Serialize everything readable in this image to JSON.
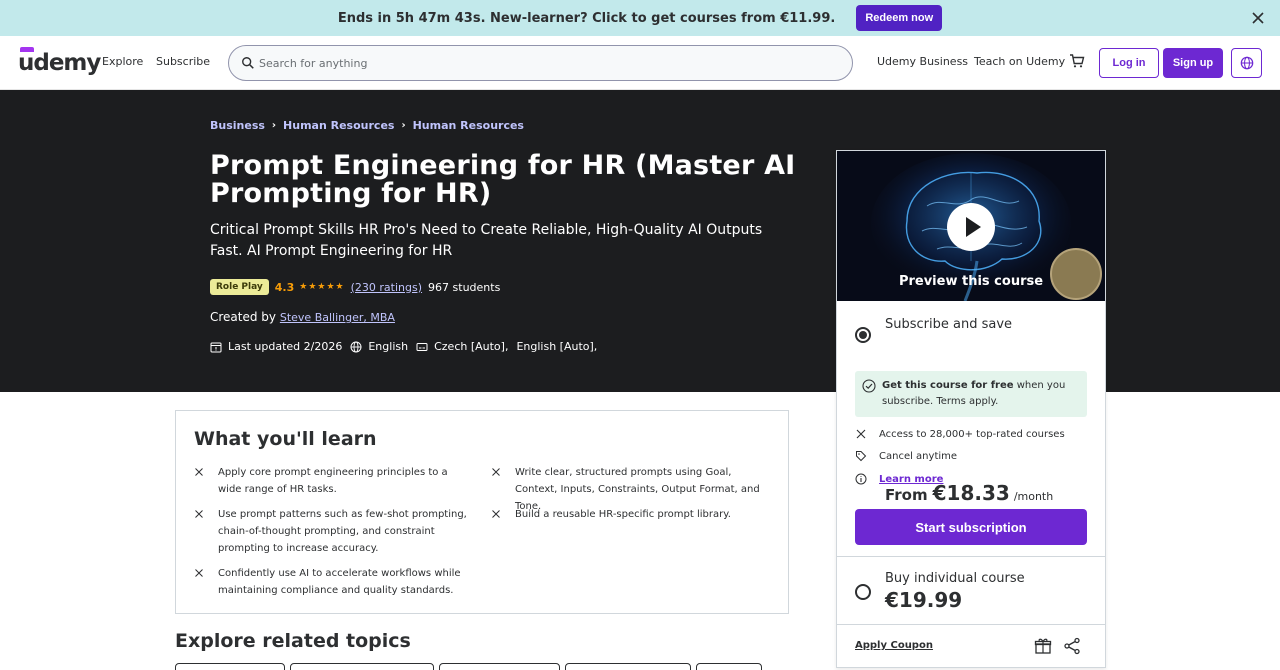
{
  "promo": {
    "text": "Ends in 5h 47m 43s. New-learner? Click to get courses from €11.99.",
    "button": "Redeem now"
  },
  "header": {
    "logo": "udemy",
    "explore": "Explore",
    "subscribe": "Subscribe",
    "search_placeholder": "Search for anything",
    "business": "Udemy Business",
    "teach": "Teach on Udemy",
    "login": "Log in",
    "signup": "Sign up"
  },
  "breadcrumbs": [
    "Business",
    "Human Resources",
    "Human Resources"
  ],
  "course": {
    "title": "Prompt Engineering for HR (Master AI Prompting for HR)",
    "subtitle": "Critical Prompt Skills HR Pro's Need to Create Reliable, High-Quality AI Outputs Fast. AI Prompt Engineering for HR",
    "badge": "Role Play",
    "rating": "4.3",
    "rating_stars": 4.3,
    "rating_count": "(230 ratings)",
    "students": "967 students",
    "created_label": "Created by",
    "author": "Steve Ballinger, MBA",
    "last_updated": "Last updated 2/2026",
    "language": "English",
    "captions": [
      "Czech [Auto],",
      "English [Auto],"
    ]
  },
  "sidebar": {
    "preview": "Preview this course",
    "sub_title": "Subscribe and save",
    "sub_from": "From",
    "sub_price": "€18.33",
    "sub_per": "/month",
    "free_bold": "Get this course for free",
    "free_rest": " when you subscribe. Terms apply.",
    "features": [
      "Access to 28,000+ top-rated courses",
      "Cancel anytime",
      "Learn more"
    ],
    "start_button": "Start subscription",
    "buy_title": "Buy individual course",
    "buy_price": "€19.99",
    "coupon": "Apply Coupon"
  },
  "learn": {
    "heading": "What you'll learn",
    "items": [
      "Apply core prompt engineering principles to a wide range of HR tasks.",
      "Use prompt patterns such as few-shot prompting, chain-of-thought prompting, and constraint prompting to increase accuracy.",
      "Confidently use AI to accelerate workflows while maintaining compliance and quality standards.",
      "Write clear, structured prompts using Goal, Context, Inputs, Constraints, Output Format, and Tone.",
      "Build a reusable HR-specific prompt library."
    ]
  },
  "explore": {
    "heading": "Explore related topics"
  }
}
